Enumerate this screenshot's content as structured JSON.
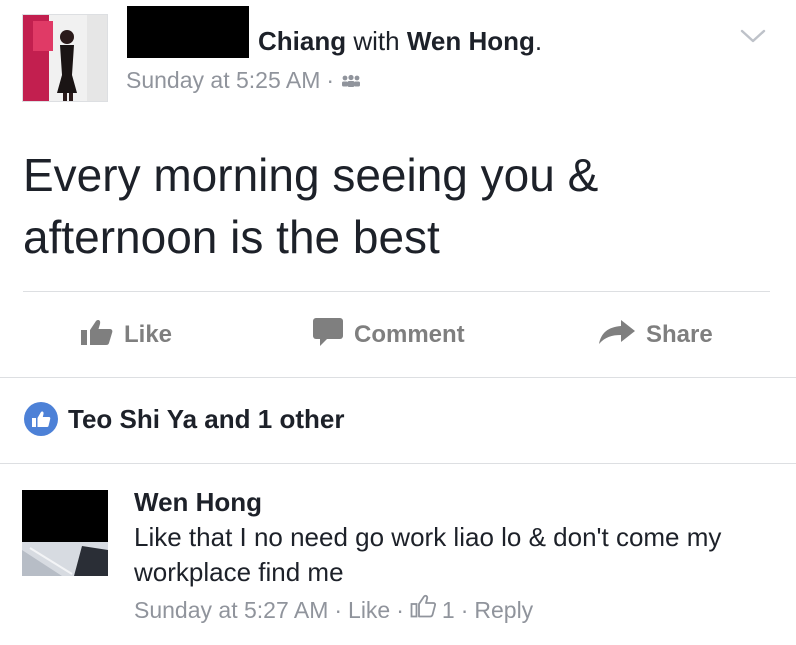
{
  "post": {
    "author_suffix": "Chiang",
    "with_word": "with",
    "tagged": "Wen Hong",
    "period": ".",
    "timestamp": "Sunday at 5:25 AM",
    "separator": "·",
    "audience_icon": "friends-icon",
    "text_line1": "Every morning seeing you &",
    "text_line2": "afternoon is the best"
  },
  "actions": {
    "like_label": "Like",
    "comment_label": "Comment",
    "share_label": "Share"
  },
  "reactions": {
    "summary": "Teo Shi Ya and 1 other"
  },
  "comment": {
    "author": "Wen Hong",
    "text": "Like that I no need go work liao lo & don't come my workplace find me",
    "timestamp": "Sunday at 5:27 AM",
    "sep1": "·",
    "like_label": "Like",
    "sep2": "·",
    "like_count": "1",
    "sep3": "·",
    "reply_label": "Reply"
  },
  "colors": {
    "text": "#1d2129",
    "meta": "#90949c",
    "action": "#7f7f7f",
    "like_blue": "#4d81d7",
    "divider": "#dddfe2"
  }
}
